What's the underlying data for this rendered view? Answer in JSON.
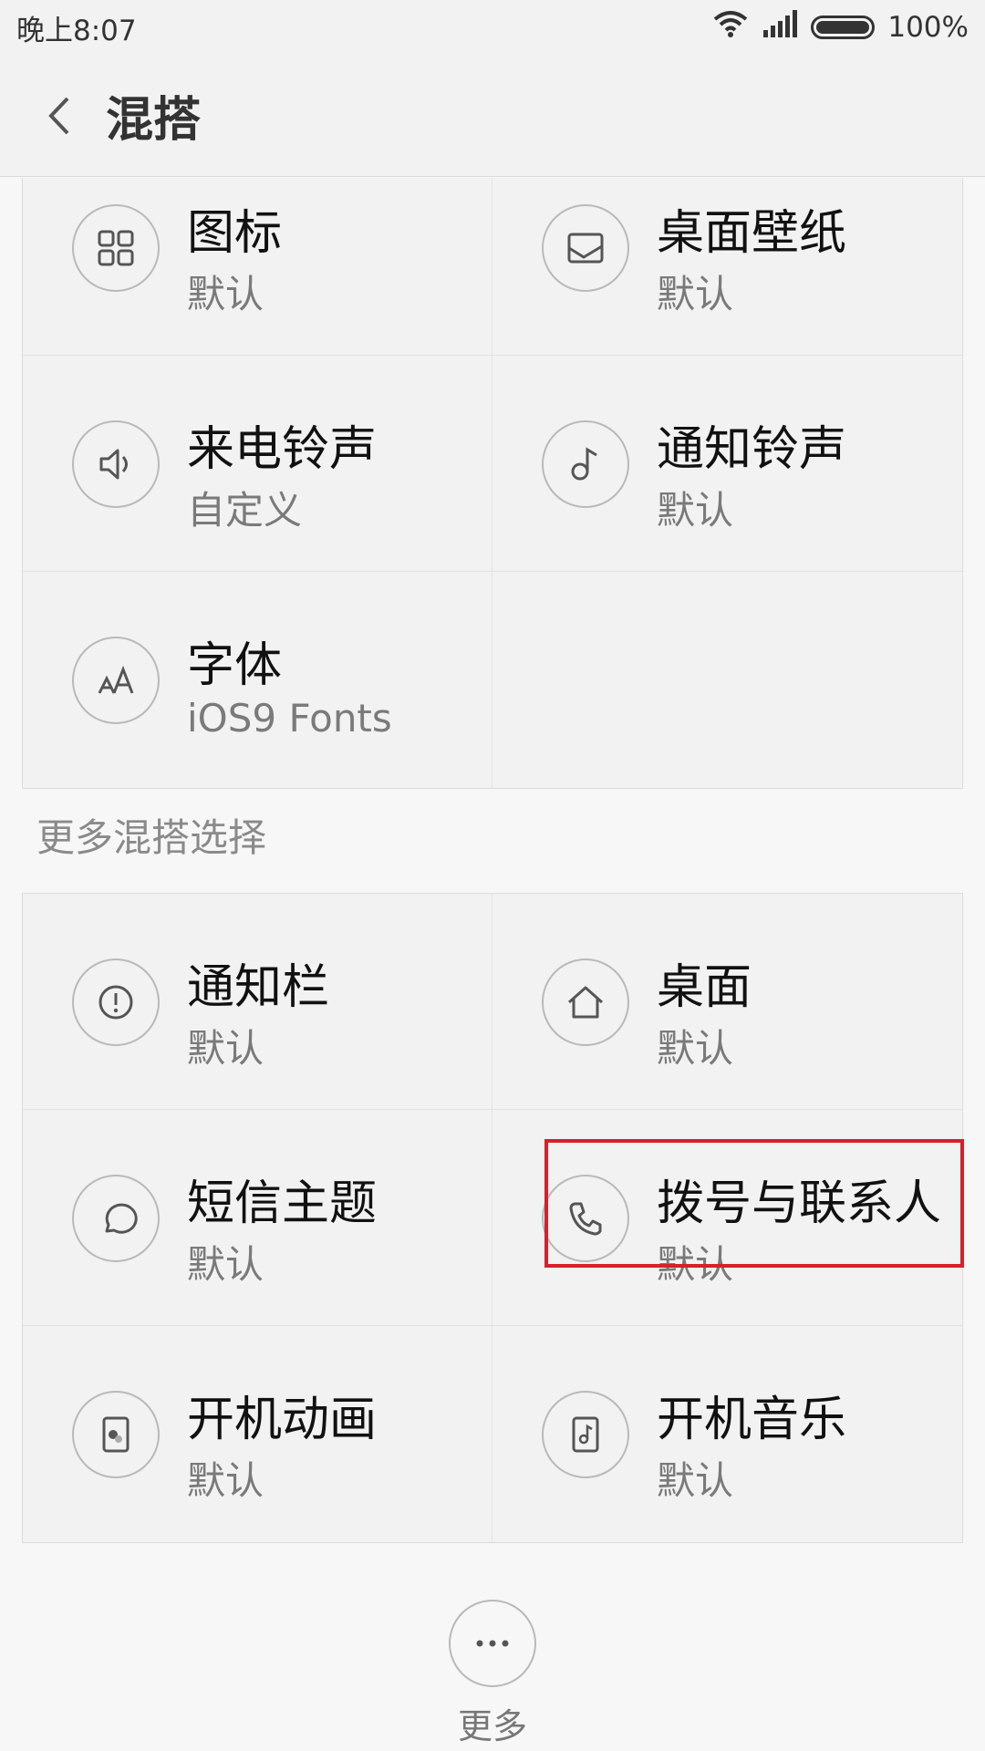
{
  "status": {
    "time": "晚上8:07",
    "battery": "100%"
  },
  "header": {
    "title": "混搭"
  },
  "grid1": [
    {
      "name": "icons",
      "title": "图标",
      "sub": "默认",
      "icon": "grid-icon"
    },
    {
      "name": "wallpaper",
      "title": "桌面壁纸",
      "sub": "默认",
      "icon": "wallpaper-icon"
    },
    {
      "name": "ringtone",
      "title": "来电铃声",
      "sub": "自定义",
      "icon": "speaker-icon"
    },
    {
      "name": "notification-sound",
      "title": "通知铃声",
      "sub": "默认",
      "icon": "music-note-icon"
    },
    {
      "name": "font",
      "title": "字体",
      "sub": "iOS9 Fonts",
      "icon": "font-icon"
    }
  ],
  "section": {
    "more_label": "更多混搭选择"
  },
  "grid2": [
    {
      "name": "notification-bar",
      "title": "通知栏",
      "sub": "默认",
      "icon": "alert-icon"
    },
    {
      "name": "desktop",
      "title": "桌面",
      "sub": "默认",
      "icon": "home-icon"
    },
    {
      "name": "messages-theme",
      "title": "短信主题",
      "sub": "默认",
      "icon": "chat-bubble-icon"
    },
    {
      "name": "dialer-contacts",
      "title": "拨号与联系人",
      "sub": "默认",
      "icon": "phone-icon"
    },
    {
      "name": "boot-animation",
      "title": "开机动画",
      "sub": "默认",
      "icon": "boot-animation-icon"
    },
    {
      "name": "boot-music",
      "title": "开机音乐",
      "sub": "默认",
      "icon": "music-file-icon"
    }
  ],
  "footer": {
    "more": "更多"
  }
}
